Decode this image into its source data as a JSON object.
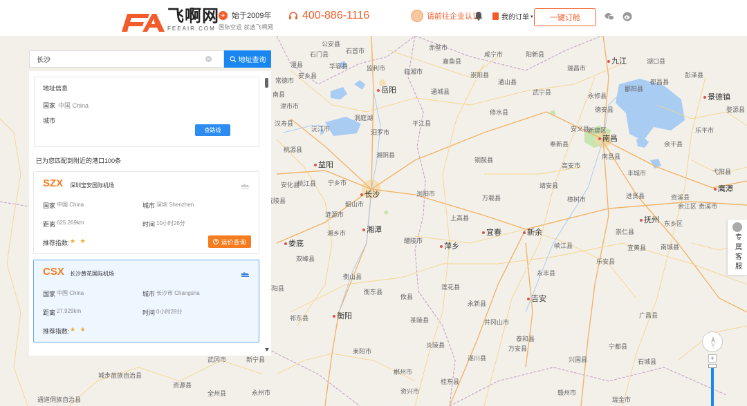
{
  "header": {
    "logo_text": "飞啊网",
    "logo_sub": "FEEAIR.COM",
    "slogan_top": "始于2009年",
    "slogan_bottom": "国际空运 就选飞啊网",
    "phone": "400-886-1116",
    "cert": "请前往企业认证",
    "my_orders": "我的订单",
    "book_button": "一键订舱"
  },
  "search": {
    "value": "长沙",
    "button": "地址查询"
  },
  "address_info": {
    "title": "地址信息",
    "country_label": "国家",
    "country_value": "中国  China",
    "city_label": "城市",
    "route_button": "查路线"
  },
  "match_text": "已为您匹配到附近的港口100条",
  "ports": [
    {
      "code": "SZX",
      "name": "深圳宝安国际机场",
      "country_label": "国家",
      "country": "中国 China",
      "city_label": "城市",
      "city": "深圳 Shenzhen",
      "distance_label": "距离",
      "distance": "625.269km",
      "time_label": "时间",
      "time": "10小时26分",
      "rating_label": "推荐指数:",
      "stars": "★ ★",
      "freight_button": "运价查询"
    },
    {
      "code": "CSX",
      "name": "长沙黄花国际机场",
      "country_label": "国家",
      "country": "中国 China",
      "city_label": "城市",
      "city": "长沙市 Changsha",
      "distance_label": "距离",
      "distance": "27.929km",
      "time_label": "时间",
      "time": "0小时28分",
      "rating_label": "推荐指数:",
      "stars": "★ ★"
    }
  ],
  "service": {
    "text": "专属客服"
  },
  "map": {
    "cities": [
      {
        "name": "长沙",
        "big": true
      },
      {
        "name": "南昌",
        "big": true
      },
      {
        "name": "九江",
        "big": true
      },
      {
        "name": "岳阳",
        "big": true
      },
      {
        "name": "益阳",
        "big": true
      },
      {
        "name": "湘潭",
        "big": true
      },
      {
        "name": "萍乡",
        "big": true
      },
      {
        "name": "宜春",
        "big": true
      },
      {
        "name": "新余",
        "big": true
      },
      {
        "name": "抚州",
        "big": true
      },
      {
        "name": "鹰潭",
        "big": true
      },
      {
        "name": "吉安",
        "big": true
      },
      {
        "name": "衡阳",
        "big": true
      },
      {
        "name": "娄底",
        "big": true
      },
      {
        "name": "景德镇",
        "big": true
      },
      {
        "name": "洞庭湖"
      },
      {
        "name": "鄱阳县"
      },
      {
        "name": "湘阴县"
      },
      {
        "name": "浏阳市"
      },
      {
        "name": "醴陵市"
      },
      {
        "name": "平江县"
      },
      {
        "name": "通城县"
      },
      {
        "name": "修水县"
      },
      {
        "name": "铜鼓县"
      },
      {
        "name": "万载县"
      },
      {
        "name": "上高县"
      },
      {
        "name": "高安市"
      },
      {
        "name": "丰城市"
      },
      {
        "name": "樟树市"
      },
      {
        "name": "崇仁县"
      },
      {
        "name": "宜黄县"
      },
      {
        "name": "南城县"
      },
      {
        "name": "永新县"
      },
      {
        "name": "莲花县"
      },
      {
        "name": "茶陵县"
      },
      {
        "name": "攸县"
      },
      {
        "name": "衡山县"
      },
      {
        "name": "衡东县"
      },
      {
        "name": "韶山市"
      },
      {
        "name": "宁乡市"
      },
      {
        "name": "汨罗市"
      },
      {
        "name": "临湘市"
      },
      {
        "name": "华容县"
      },
      {
        "name": "南县"
      },
      {
        "name": "沅江市"
      },
      {
        "name": "桃江县"
      },
      {
        "name": "安化县"
      },
      {
        "name": "涟源市"
      },
      {
        "name": "双峰县"
      },
      {
        "name": "湘乡市"
      },
      {
        "name": "泰和县"
      },
      {
        "name": "万安县"
      },
      {
        "name": "遂川县"
      },
      {
        "name": "永丰县"
      },
      {
        "name": "乐安县"
      },
      {
        "name": "峡江县"
      },
      {
        "name": "资溪县"
      },
      {
        "name": "广昌县"
      },
      {
        "name": "宁都县"
      },
      {
        "name": "兴国县"
      },
      {
        "name": "石城县"
      },
      {
        "name": "瑞金市"
      },
      {
        "name": "耒阳市"
      },
      {
        "name": "郴州市"
      },
      {
        "name": "桂东县"
      },
      {
        "name": "炎陵县"
      },
      {
        "name": "井冈山市"
      },
      {
        "name": "赣州市"
      },
      {
        "name": "资兴市"
      },
      {
        "name": "祁东县"
      },
      {
        "name": "邵阳县"
      },
      {
        "name": "武冈市"
      },
      {
        "name": "新宁县"
      },
      {
        "name": "永州市"
      },
      {
        "name": "全州县"
      },
      {
        "name": "资源县"
      },
      {
        "name": "城步苗族自治县"
      },
      {
        "name": "通道侗族自治县"
      },
      {
        "name": "石门县"
      },
      {
        "name": "安乡县"
      },
      {
        "name": "常德市"
      },
      {
        "name": "汉寿县"
      },
      {
        "name": "桃源县"
      },
      {
        "name": "沅陵县"
      },
      {
        "name": "余干县"
      },
      {
        "name": "余江区"
      },
      {
        "name": "贵溪市"
      },
      {
        "name": "弋阳县"
      },
      {
        "name": "乐平市"
      },
      {
        "name": "婺源县"
      },
      {
        "name": "都昌县"
      },
      {
        "name": "湖口县"
      },
      {
        "name": "彭泽县"
      },
      {
        "name": "东乡区"
      },
      {
        "name": "进贤县"
      },
      {
        "name": "南昌县"
      },
      {
        "name": "新建区"
      },
      {
        "name": "安义县"
      },
      {
        "name": "奉新县"
      },
      {
        "name": "靖安县"
      },
      {
        "name": "永修县"
      },
      {
        "name": "德安县"
      },
      {
        "name": "武宁县"
      },
      {
        "name": "瑞昌市"
      },
      {
        "name": "阳新县"
      },
      {
        "name": "崇阳县"
      },
      {
        "name": "通山县"
      },
      {
        "name": "咸宁市"
      },
      {
        "name": "嘉鱼县"
      },
      {
        "name": "赤壁市"
      },
      {
        "name": "监利市"
      },
      {
        "name": "石首市"
      },
      {
        "name": "公安县"
      },
      {
        "name": "澧县"
      },
      {
        "name": "津市市"
      }
    ]
  }
}
